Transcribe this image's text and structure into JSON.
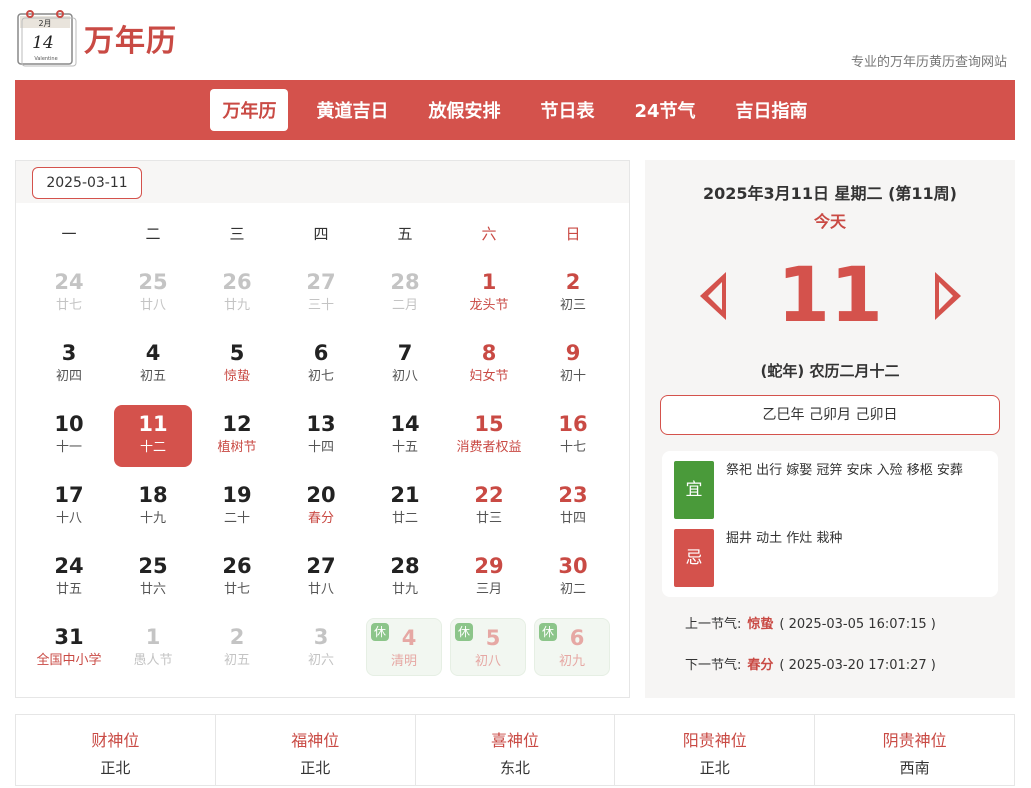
{
  "header": {
    "logo_icon_month": "2月",
    "logo_icon_day": "14",
    "logo_icon_sub": "Valentine",
    "logo_text": "万年历",
    "tagline": "专业的万年历黄历查询网站"
  },
  "nav": {
    "items": [
      {
        "label": "万年历"
      },
      {
        "label": "黄道吉日"
      },
      {
        "label": "放假安排"
      },
      {
        "label": "节日表"
      },
      {
        "label": "24节气"
      },
      {
        "label": "吉日指南"
      }
    ]
  },
  "calendar": {
    "date_value": "2025-03-11",
    "weekdays": [
      "一",
      "二",
      "三",
      "四",
      "五",
      "六",
      "日"
    ],
    "rest_badge": "休",
    "weeks": [
      [
        {
          "n": "24",
          "s": "廿七",
          "type": "other"
        },
        {
          "n": "25",
          "s": "廿八",
          "type": "other"
        },
        {
          "n": "26",
          "s": "廿九",
          "type": "other"
        },
        {
          "n": "27",
          "s": "三十",
          "type": "other"
        },
        {
          "n": "28",
          "s": "二月",
          "type": "other"
        },
        {
          "n": "1",
          "s": "龙头节",
          "type": "weekend festival"
        },
        {
          "n": "2",
          "s": "初三",
          "type": "weekend"
        }
      ],
      [
        {
          "n": "3",
          "s": "初四",
          "type": ""
        },
        {
          "n": "4",
          "s": "初五",
          "type": ""
        },
        {
          "n": "5",
          "s": "惊蛰",
          "type": "festival"
        },
        {
          "n": "6",
          "s": "初七",
          "type": ""
        },
        {
          "n": "7",
          "s": "初八",
          "type": ""
        },
        {
          "n": "8",
          "s": "妇女节",
          "type": "weekend festival"
        },
        {
          "n": "9",
          "s": "初十",
          "type": "weekend"
        }
      ],
      [
        {
          "n": "10",
          "s": "十一",
          "type": ""
        },
        {
          "n": "11",
          "s": "十二",
          "type": "today"
        },
        {
          "n": "12",
          "s": "植树节",
          "type": "festival"
        },
        {
          "n": "13",
          "s": "十四",
          "type": ""
        },
        {
          "n": "14",
          "s": "十五",
          "type": ""
        },
        {
          "n": "15",
          "s": "消费者权益",
          "type": "weekend festival"
        },
        {
          "n": "16",
          "s": "十七",
          "type": "weekend"
        }
      ],
      [
        {
          "n": "17",
          "s": "十八",
          "type": ""
        },
        {
          "n": "18",
          "s": "十九",
          "type": ""
        },
        {
          "n": "19",
          "s": "二十",
          "type": ""
        },
        {
          "n": "20",
          "s": "春分",
          "type": "festival"
        },
        {
          "n": "21",
          "s": "廿二",
          "type": ""
        },
        {
          "n": "22",
          "s": "廿三",
          "type": "weekend"
        },
        {
          "n": "23",
          "s": "廿四",
          "type": "weekend"
        }
      ],
      [
        {
          "n": "24",
          "s": "廿五",
          "type": ""
        },
        {
          "n": "25",
          "s": "廿六",
          "type": ""
        },
        {
          "n": "26",
          "s": "廿七",
          "type": ""
        },
        {
          "n": "27",
          "s": "廿八",
          "type": ""
        },
        {
          "n": "28",
          "s": "廿九",
          "type": ""
        },
        {
          "n": "29",
          "s": "三月",
          "type": "weekend"
        },
        {
          "n": "30",
          "s": "初二",
          "type": "weekend"
        }
      ],
      [
        {
          "n": "31",
          "s": "全国中小学",
          "type": "festival"
        },
        {
          "n": "1",
          "s": "愚人节",
          "type": "other festival-faded"
        },
        {
          "n": "2",
          "s": "初五",
          "type": "other"
        },
        {
          "n": "3",
          "s": "初六",
          "type": "other"
        },
        {
          "n": "4",
          "s": "清明",
          "type": "rest"
        },
        {
          "n": "5",
          "s": "初八",
          "type": "rest"
        },
        {
          "n": "6",
          "s": "初九",
          "type": "rest"
        }
      ]
    ]
  },
  "detail": {
    "date_line": "2025年3月11日 星期二 (第11周)",
    "today_label": "今天",
    "big_day": "11",
    "lunar_line": "(蛇年) 农历二月十二",
    "ganzhi": "乙巳年 己卯月 己卯日",
    "yi_label": "宜",
    "yi_items": "祭祀 出行 嫁娶 冠笄 安床 入殓 移柩 安葬",
    "ji_label": "忌",
    "ji_items": "掘井 动土 作灶 栽种",
    "prev_jq_label": "上一节气:",
    "prev_jq_name": "惊蛰",
    "prev_jq_time": "( 2025-03-05 16:07:15 )",
    "next_jq_label": "下一节气:",
    "next_jq_name": "春分",
    "next_jq_time": "( 2025-03-20 17:01:27 )"
  },
  "gods": [
    {
      "label": "财神位",
      "value": "正北"
    },
    {
      "label": "福神位",
      "value": "正北"
    },
    {
      "label": "喜神位",
      "value": "东北"
    },
    {
      "label": "阳贵神位",
      "value": "正北"
    },
    {
      "label": "阴贵神位",
      "value": "西南"
    }
  ],
  "colors": {
    "accent": "#d4524c",
    "yi": "#4a9a3a",
    "rest_bg": "#f2f7f1"
  }
}
